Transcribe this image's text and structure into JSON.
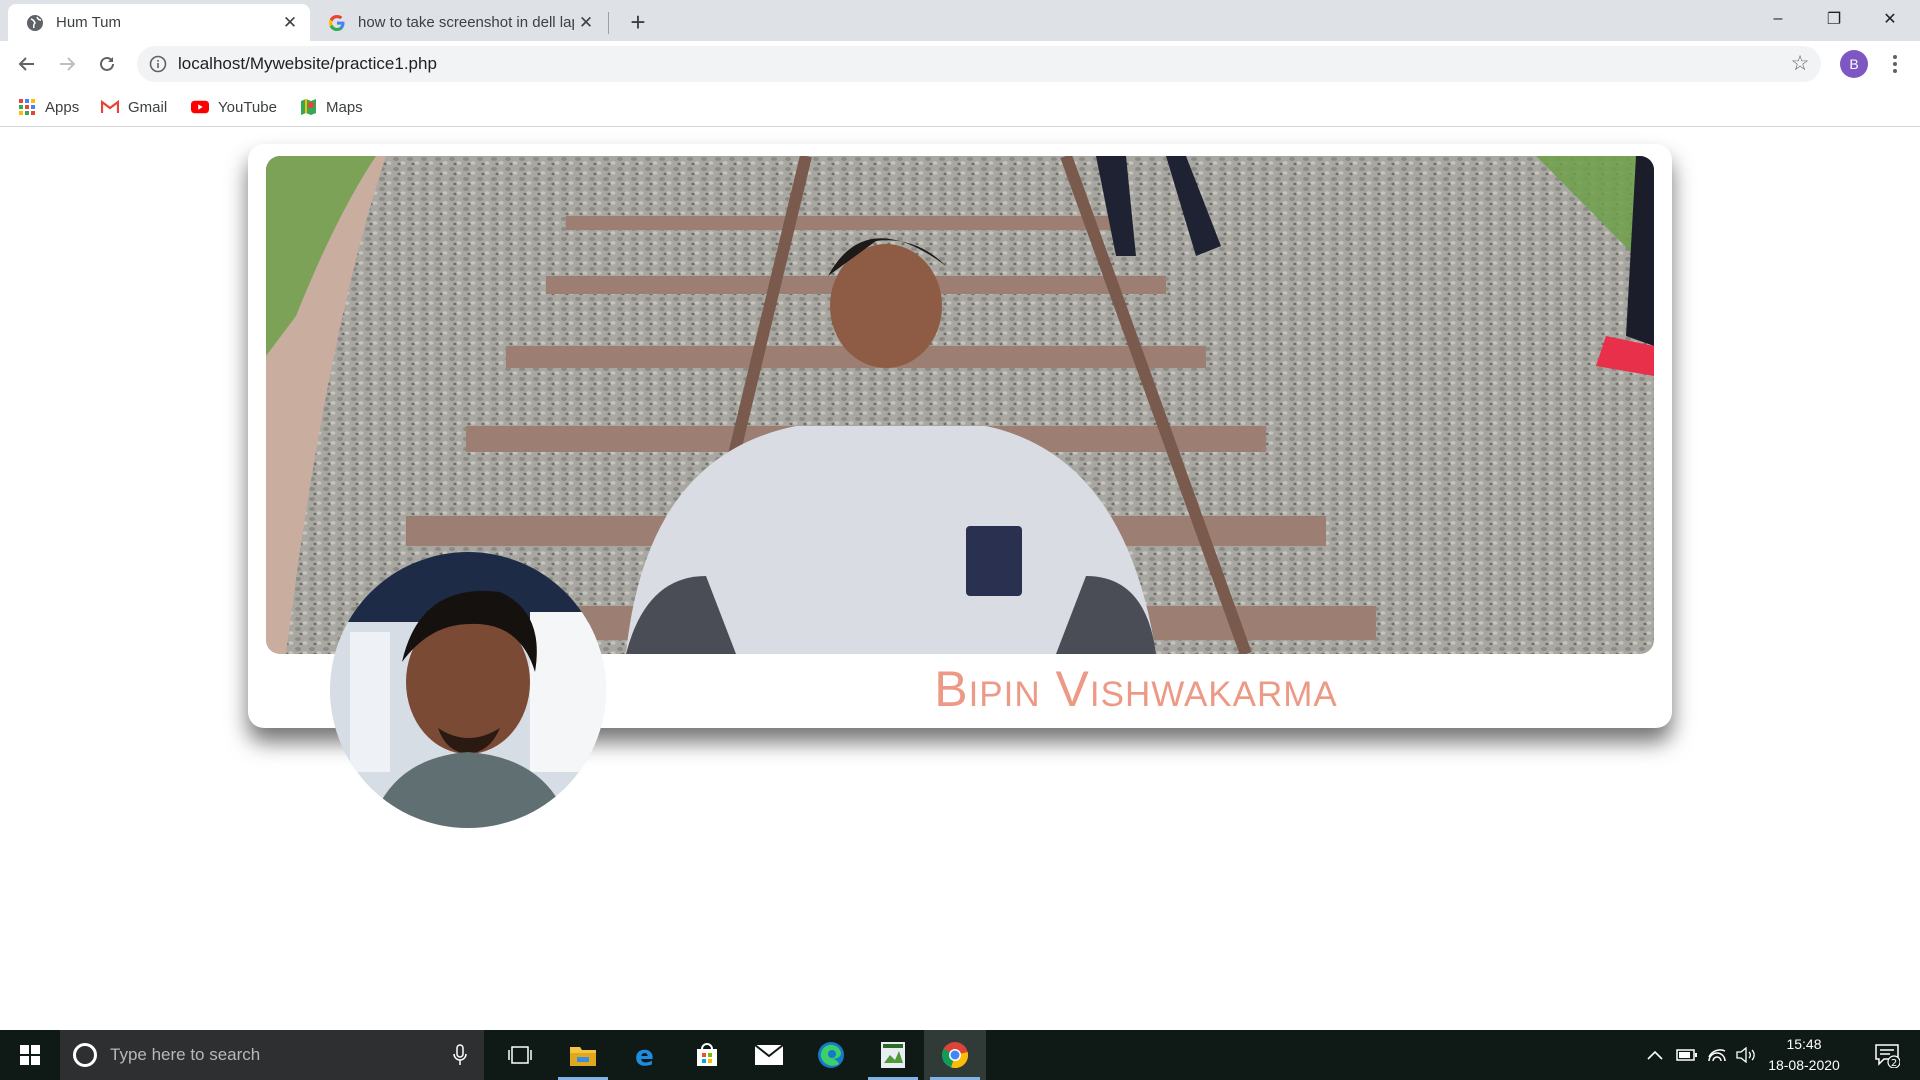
{
  "browser": {
    "tabs": [
      {
        "title": "Hum Tum",
        "favicon": "globe-icon",
        "active": true
      },
      {
        "title": "how to take screenshot in dell lap",
        "favicon": "google-icon",
        "active": false
      }
    ],
    "new_tab_label": "+",
    "window_controls": {
      "minimize": "–",
      "maximize": "❐",
      "close": "✕"
    },
    "url": "localhost/Mywebsite/practice1.php",
    "profile_initial": "B",
    "bookmarks": [
      {
        "label": "Apps",
        "icon": "apps-grid-icon"
      },
      {
        "label": "Gmail",
        "icon": "gmail-icon"
      },
      {
        "label": "YouTube",
        "icon": "youtube-icon"
      },
      {
        "label": "Maps",
        "icon": "maps-icon"
      }
    ]
  },
  "page": {
    "profile_name": "Bipin Vishwakarma",
    "name_color": "#ec9a86"
  },
  "taskbar": {
    "search_placeholder": "Type here to search",
    "apps": [
      "task-view-icon",
      "file-explorer-icon",
      "edge-legacy-icon",
      "store-icon",
      "mail-icon",
      "edge-chromium-icon",
      "xampp-icon",
      "chrome-icon"
    ],
    "tray_icons": [
      "chevron-up-icon",
      "battery-icon",
      "wifi-icon",
      "volume-icon"
    ],
    "time": "15:48",
    "date": "18-08-2020",
    "notification_count": "2"
  }
}
